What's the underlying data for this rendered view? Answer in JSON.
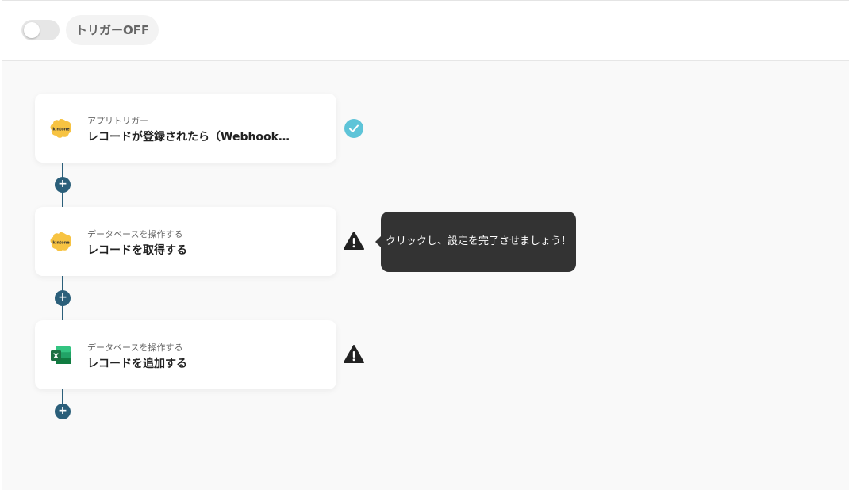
{
  "header": {
    "trigger_toggle": {
      "state": "off"
    },
    "trigger_label": "トリガーOFF"
  },
  "steps": [
    {
      "icon": "kintone-icon",
      "icon_text": "kintone",
      "subtitle": "アプリトリガー",
      "title": "レコードが登録されたら（Webhook起動）",
      "status": "complete"
    },
    {
      "icon": "kintone-icon",
      "icon_text": "kintone",
      "subtitle": "データベースを操作する",
      "title": "レコードを取得する",
      "status": "warning"
    },
    {
      "icon": "excel-icon",
      "icon_text": "X",
      "subtitle": "データベースを操作する",
      "title": "レコードを追加する",
      "status": "warning"
    }
  ],
  "tooltip": {
    "text": "クリックし、設定を完了させましょう！"
  },
  "colors": {
    "connector": "#2b5f7a",
    "success": "#5ec4d8",
    "warning": "#222222",
    "tooltip_bg": "#333333",
    "kintone": "#f7c342",
    "excel": "#1d6f42"
  }
}
